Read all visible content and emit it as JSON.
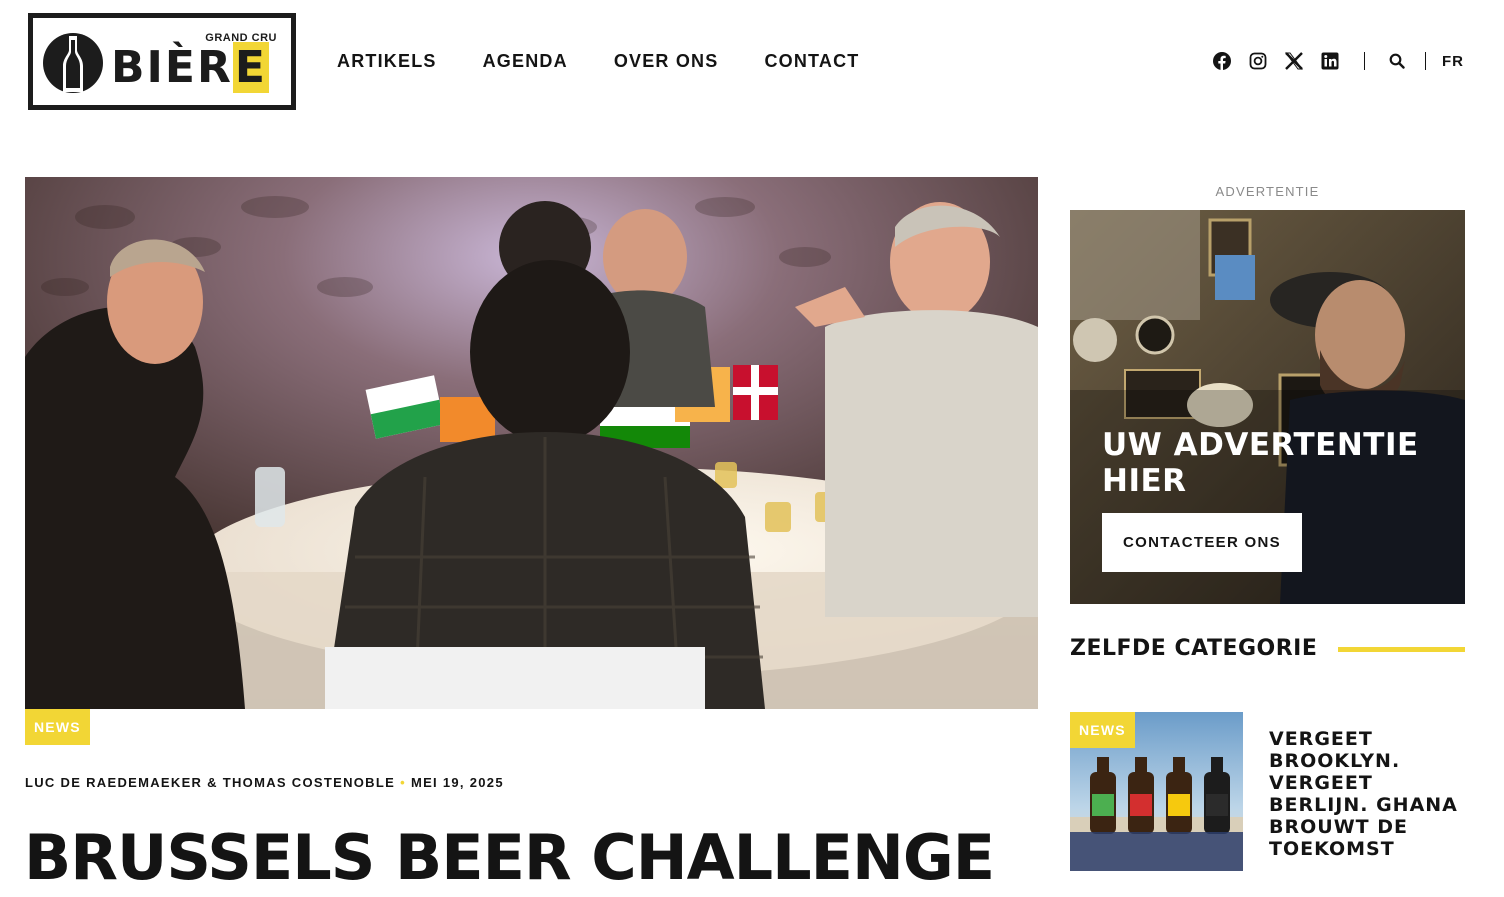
{
  "brand": {
    "logo_word_prefix": "BIÈR",
    "logo_word_accent": "E",
    "logo_tagline": "GRAND CRU",
    "accent_color": "#f2d635",
    "dark_color": "#141414"
  },
  "nav": {
    "items": [
      {
        "label": "ARTIKELS"
      },
      {
        "label": "AGENDA"
      },
      {
        "label": "OVER ONS"
      },
      {
        "label": "CONTACT"
      }
    ]
  },
  "header_tools": {
    "social_icons": [
      "facebook-icon",
      "instagram-icon",
      "x-icon",
      "linkedin-icon"
    ],
    "search_icon": "search-icon",
    "language": "FR"
  },
  "article": {
    "category": "NEWS",
    "authors": "LUC DE RAEDEMAEKER & THOMAS COSTENOBLE",
    "date": "MEI 19, 2025",
    "title": "BRUSSELS BEER CHALLENGE"
  },
  "sidebar": {
    "ad_label": "ADVERTENTIE",
    "ad_headline": "UW ADVERTENTIE HIER",
    "ad_button": "CONTACTEER ONS",
    "section_title": "ZELFDE CATEGORIE",
    "related": [
      {
        "category": "NEWS",
        "title": "VERGEET BROOKLYN. VERGEET BERLIJN. GHANA BROUWT DE TOEKOMST"
      }
    ]
  }
}
